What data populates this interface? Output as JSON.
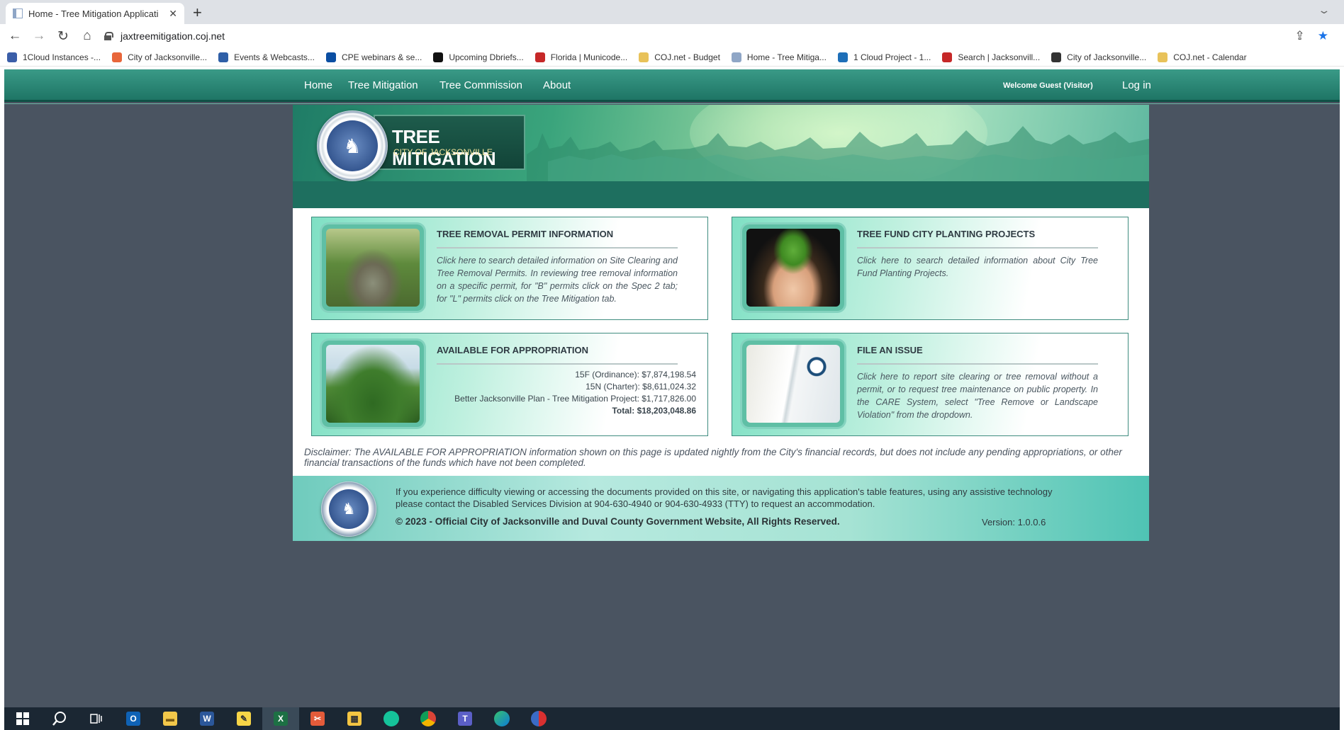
{
  "browser": {
    "tab": {
      "title": "Home - Tree Mitigation Applicati",
      "close": "✕"
    },
    "new_tab": "+",
    "url": "jaxtreemitigation.coj.net",
    "bookmarks": [
      {
        "label": "1Cloud Instances -...",
        "color": "#3b5ea8"
      },
      {
        "label": "City of Jacksonville...",
        "color": "#e8663a"
      },
      {
        "label": "Events & Webcasts...",
        "color": "#2f5fa7"
      },
      {
        "label": "CPE webinars & se...",
        "color": "#0b4ea2"
      },
      {
        "label": "Upcoming Dbriefs...",
        "color": "#111111"
      },
      {
        "label": "Florida | Municode...",
        "color": "#c62828"
      },
      {
        "label": "COJ.net - Budget",
        "color": "#e8c25a"
      },
      {
        "label": "Home - Tree Mitiga...",
        "color": "#8fa6c6"
      },
      {
        "label": "1 Cloud Project - 1...",
        "color": "#1e6fb8"
      },
      {
        "label": "Search | Jacksonvill...",
        "color": "#c62828"
      },
      {
        "label": "City of Jacksonville...",
        "color": "#333333"
      },
      {
        "label": "COJ.net - Calendar",
        "color": "#e8c25a"
      }
    ]
  },
  "nav": {
    "items": [
      "Home",
      "Tree Mitigation",
      "Tree Commission",
      "About"
    ],
    "welcome": "Welcome Guest (Visitor)",
    "login": "Log in"
  },
  "banner": {
    "title": "TREE MITIGATION",
    "subtitle": "CITY OF JACKSONVILLE"
  },
  "cards": {
    "removal": {
      "title": "TREE REMOVAL PERMIT INFORMATION",
      "text": "Click here to search detailed information on Site Clearing and Tree Removal Permits. In reviewing tree removal information on a specific permit, for \"B\" permits click on the Spec 2 tab; for \"L\" permits click on the Tree Mitigation tab."
    },
    "fund": {
      "title": "TREE FUND CITY PLANTING PROJECTS",
      "text": "Click here to search detailed information about City Tree Fund Planting Projects."
    },
    "appropriation": {
      "title": "AVAILABLE FOR APPROPRIATION",
      "lines": [
        "15F (Ordinance): $7,874,198.54",
        "15N (Charter): $8,611,024.32",
        "Better Jacksonville Plan - Tree Mitigation Project: $1,717,826.00"
      ],
      "total": "Total: $18,203,048.86"
    },
    "issue": {
      "title": "FILE AN ISSUE",
      "text": "Click here to report site clearing or tree removal without a permit, or to request tree maintenance on public property. In the CARE System, select \"Tree Remove or Landscape Violation\" from the dropdown."
    }
  },
  "disclaimer": "Disclaimer: The AVAILABLE FOR APPROPRIATION information shown on this page is updated nightly from the City's financial records, but does not include any pending appropriations, or other financial transactions of the funds which have not been completed.",
  "footer": {
    "accessibility": "If you experience difficulty viewing or accessing the documents provided on this site, or navigating this application's table features, using any assistive technology please contact the Disabled Services Division at 904-630-4940 or 904-630-4933 (TTY) to request an accommodation.",
    "copyright": "© 2023 - Official City of Jacksonville and Duval County Government Website, All Rights Reserved.",
    "version": "Version: 1.0.0.6"
  },
  "taskbar": {
    "apps": [
      "windows-start-icon",
      "search-icon",
      "task-view-icon",
      "outlook-icon",
      "file-explorer-icon",
      "word-icon",
      "sticky-notes-icon",
      "excel-icon",
      "snipping-icon",
      "calculator-icon",
      "grammarly-icon",
      "chrome-icon",
      "teams-icon",
      "edge-icon",
      "remote-app-icon"
    ]
  },
  "colors": {
    "nav_green": "#2a8574",
    "page_bg": "#4a5461",
    "band_green": "#1e6f5f",
    "accent_blue": "#1a73e8"
  }
}
